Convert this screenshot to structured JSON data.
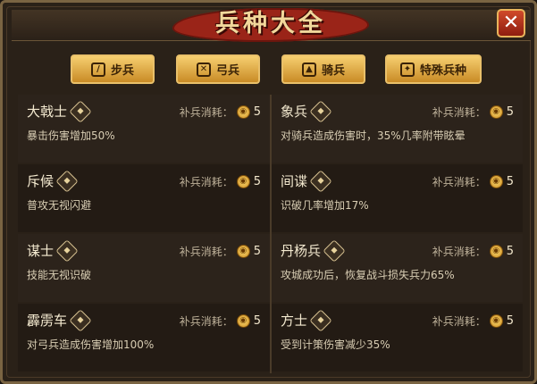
{
  "window": {
    "title": "兵种大全",
    "close_icon": "✕"
  },
  "tabs": [
    {
      "label": "步兵",
      "icon": "sword-icon",
      "glyph": "/"
    },
    {
      "label": "弓兵",
      "icon": "bow-icon",
      "glyph": "✕"
    },
    {
      "label": "骑兵",
      "icon": "horse-icon",
      "glyph": "▲"
    },
    {
      "label": "特殊兵种",
      "icon": "special-icon",
      "glyph": "✦"
    }
  ],
  "cost_label": "补兵消耗：",
  "coin_glyph": "◉",
  "units": [
    {
      "name": "大戟士",
      "cost": "5",
      "desc": "暴击伤害增加50%"
    },
    {
      "name": "象兵",
      "cost": "5",
      "desc": "对骑兵造成伤害时，35%几率附带眩晕"
    },
    {
      "name": "斥候",
      "cost": "5",
      "desc": "普攻无视闪避"
    },
    {
      "name": "间谍",
      "cost": "5",
      "desc": "识破几率增加17%"
    },
    {
      "name": "谋士",
      "cost": "5",
      "desc": "技能无视识破"
    },
    {
      "name": "丹杨兵",
      "cost": "5",
      "desc": "攻城成功后，恢复战斗损失兵力65%"
    },
    {
      "name": "霹雳车",
      "cost": "5",
      "desc": "对弓兵造成伤害增加100%"
    },
    {
      "name": "方士",
      "cost": "5",
      "desc": "受到计策伤害减少35%"
    }
  ],
  "colors": {
    "accent": "#e9c06a",
    "title_red": "#9a2418",
    "panel": "#2a2118"
  }
}
